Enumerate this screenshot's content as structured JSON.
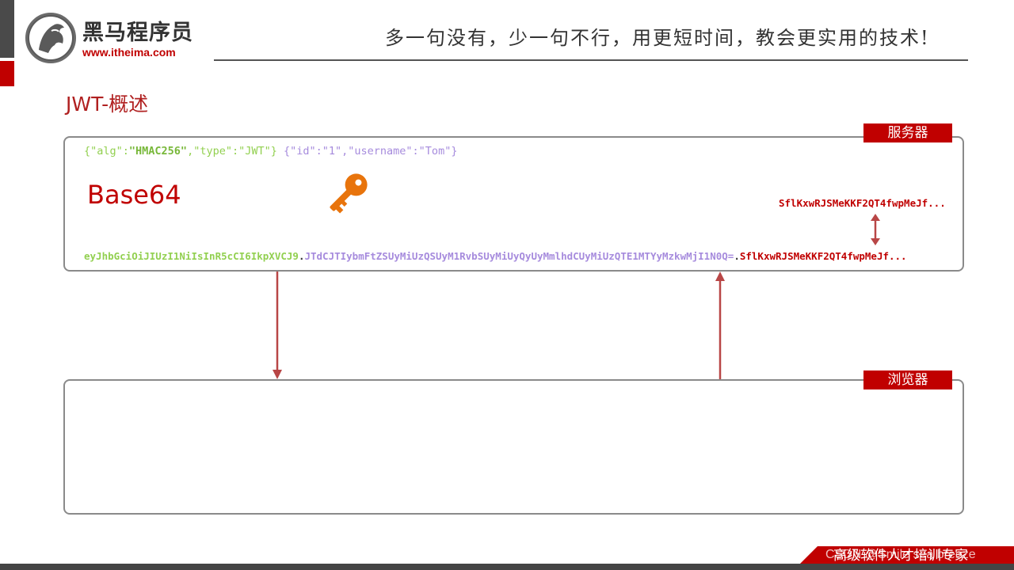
{
  "header": {
    "logo_name": "黑马程序员",
    "logo_url": "www.itheima.com",
    "slogan": "多一句没有，少一句不行，用更短时间，教会更实用的技术!"
  },
  "slide": {
    "title": "JWT-概述"
  },
  "server": {
    "tag": "服务器",
    "json": {
      "header_part1": "{\"alg\":",
      "header_alg": "\"HMAC256\"",
      "header_part2": ",\"type\":\"JWT\"}",
      "payload": "{\"id\":\"1\",\"username\":\"Tom\"}"
    },
    "base64_label": "Base64",
    "signature_computed": "SflKxwRJSMeKKF2QT4fwpMeJf...",
    "token": {
      "header": "eyJhbGciOiJIUzI1NiIsInR5cCI6IkpXVCJ9",
      "dot1": ".",
      "payload": "JTdCJTIybmFtZSUyMiUzQSUyM1RvbSUyMiUyQyUyMmlhdCUyMiUzQTE1MTYyMzkwMjI1N0Q=",
      "dot2": ".",
      "signature": "SflKxwRJSMeKKF2QT4fwpMeJf..."
    }
  },
  "browser": {
    "tag": "浏览器"
  },
  "footer": {
    "text": "高级软件人才培训专家",
    "watermark": "CSDN @Smile sea breeze"
  },
  "colors": {
    "accent_red": "#c00000",
    "json_green": "#92d050",
    "json_purple": "#a68bdd",
    "key_orange": "#e8740c",
    "arrow_red": "#b84646"
  },
  "icons": {
    "key": "key-icon",
    "logo": "horse-logo-icon"
  }
}
